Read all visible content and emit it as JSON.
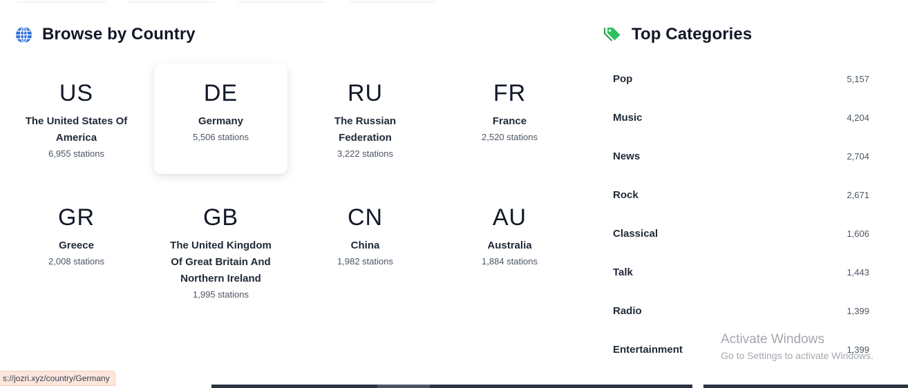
{
  "browse": {
    "title": "Browse by Country",
    "icon": "globe-icon",
    "countries": [
      {
        "code": "US",
        "name": "The United States Of America",
        "count": "6,955 stations"
      },
      {
        "code": "DE",
        "name": "Germany",
        "count": "5,506 stations",
        "hovered": true
      },
      {
        "code": "RU",
        "name": "The Russian Federation",
        "count": "3,222 stations"
      },
      {
        "code": "FR",
        "name": "France",
        "count": "2,520 stations"
      },
      {
        "code": "GR",
        "name": "Greece",
        "count": "2,008 stations"
      },
      {
        "code": "GB",
        "name": "The United Kingdom Of Great Britain And Northern Ireland",
        "count": "1,995 stations"
      },
      {
        "code": "CN",
        "name": "China",
        "count": "1,982 stations"
      },
      {
        "code": "AU",
        "name": "Australia",
        "count": "1,884 stations"
      }
    ]
  },
  "categories": {
    "title": "Top Categories",
    "icon": "tags-icon",
    "items": [
      {
        "name": "Pop",
        "count": "5,157"
      },
      {
        "name": "Music",
        "count": "4,204"
      },
      {
        "name": "News",
        "count": "2,704"
      },
      {
        "name": "Rock",
        "count": "2,671"
      },
      {
        "name": "Classical",
        "count": "1,606"
      },
      {
        "name": "Talk",
        "count": "1,443"
      },
      {
        "name": "Radio",
        "count": "1,399"
      },
      {
        "name": "Entertainment",
        "count": "1,399"
      }
    ]
  },
  "status_bar": {
    "url": "s://jozri.xyz/country/Germany"
  },
  "watermark": {
    "title": "Activate Windows",
    "subtitle": "Go to Settings to activate Windows."
  },
  "colors": {
    "globe": "#2f6fd6",
    "tag": "#22c55e",
    "text": "#111827",
    "muted": "#4b5563"
  }
}
